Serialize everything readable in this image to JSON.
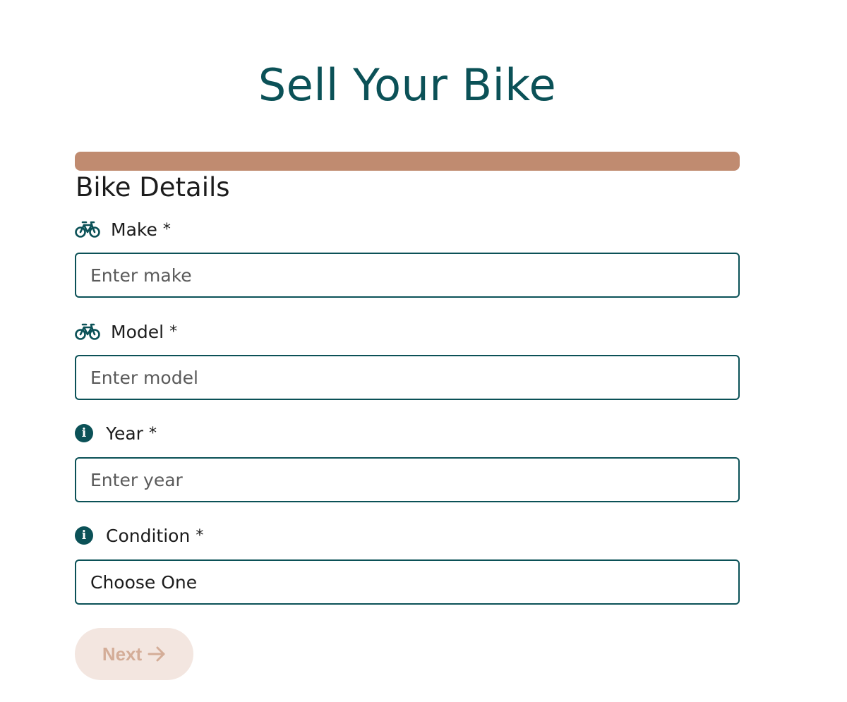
{
  "header": {
    "title": "Sell Your Bike"
  },
  "progress": {
    "fraction": 1.0,
    "color": "#c08b70"
  },
  "section": {
    "title": "Bike Details"
  },
  "fields": {
    "make": {
      "label": "Make",
      "required_mark": "*",
      "placeholder": "Enter make",
      "icon": "bicycle-icon"
    },
    "model": {
      "label": "Model",
      "required_mark": "*",
      "placeholder": "Enter model",
      "icon": "bicycle-icon"
    },
    "year": {
      "label": "Year",
      "required_mark": "*",
      "placeholder": "Enter year",
      "icon": "info-icon"
    },
    "condition": {
      "label": "Condition",
      "required_mark": "*",
      "value": "Choose One",
      "icon": "info-icon"
    }
  },
  "actions": {
    "next_label": "Next",
    "next_icon": "arrow-right-icon",
    "next_disabled": true
  },
  "colors": {
    "primary": "#0b5157",
    "accent": "#c08b70",
    "button_bg": "#f3e6e0",
    "button_text": "#d4ad98"
  }
}
